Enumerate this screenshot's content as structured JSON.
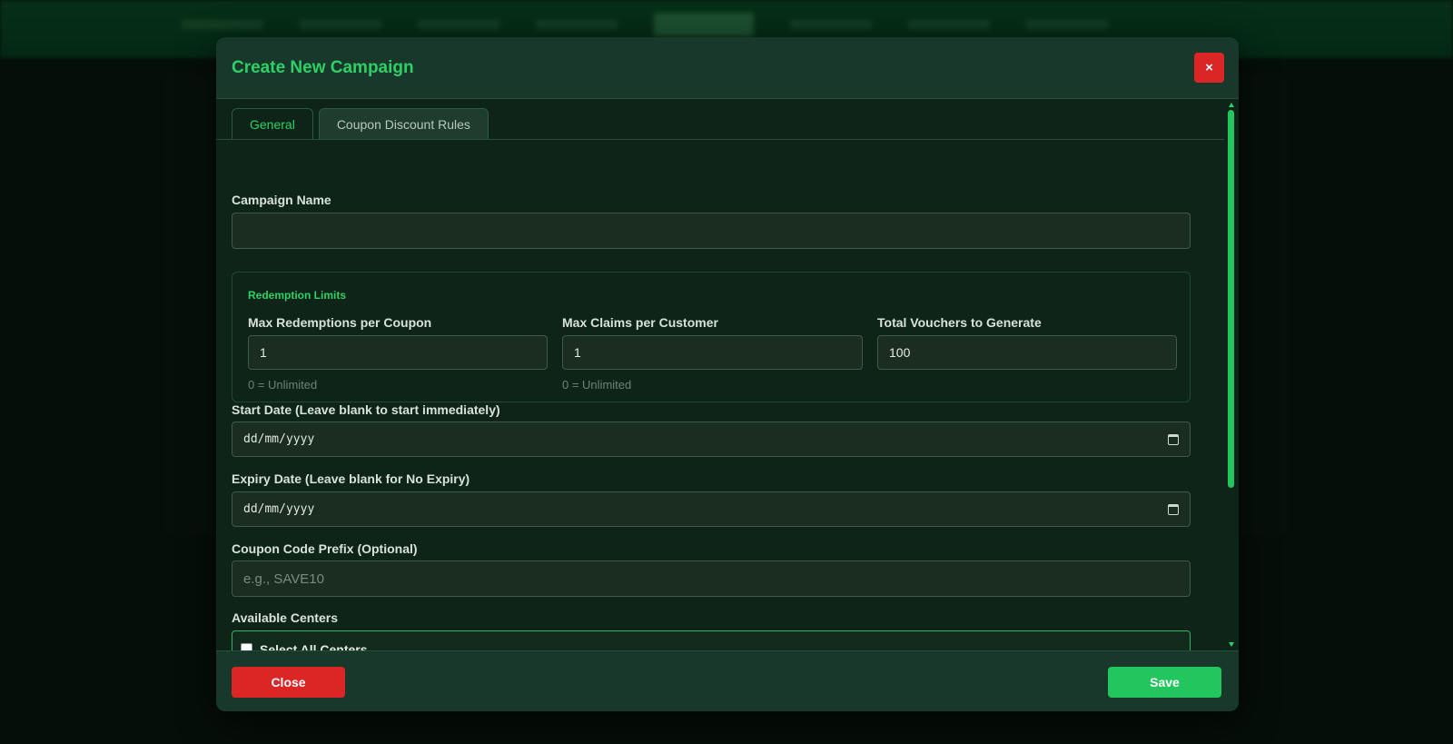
{
  "modal": {
    "title": "Create New Campaign",
    "close_icon": "×"
  },
  "tabs": [
    {
      "label": "General",
      "active": true
    },
    {
      "label": "Coupon Discount Rules",
      "active": false
    }
  ],
  "fields": {
    "campaign_name": {
      "label": "Campaign Name",
      "value": ""
    },
    "redemption_limits": {
      "legend": "Redemption Limits",
      "max_redemptions": {
        "label": "Max Redemptions per Coupon",
        "value": "1",
        "hint": "0 = Unlimited"
      },
      "max_claims": {
        "label": "Max Claims per Customer",
        "value": "1",
        "hint": "0 = Unlimited"
      },
      "total_vouchers": {
        "label": "Total Vouchers to Generate",
        "value": "100"
      }
    },
    "start_date": {
      "label": "Start Date (Leave blank to start immediately)",
      "value": "dd/mm/yyyy"
    },
    "expiry_date": {
      "label": "Expiry Date (Leave blank for No Expiry)",
      "value": "dd/mm/yyyy"
    },
    "coupon_prefix": {
      "label": "Coupon Code Prefix (Optional)",
      "placeholder": "e.g., SAVE10"
    },
    "centers": {
      "label": "Available Centers",
      "select_all": "Select All Centers",
      "checked": false
    }
  },
  "footer": {
    "close_label": "Close",
    "save_label": "Save"
  },
  "colors": {
    "accent": "#22c55e",
    "danger": "#dc2626",
    "title": "#2fd066"
  }
}
